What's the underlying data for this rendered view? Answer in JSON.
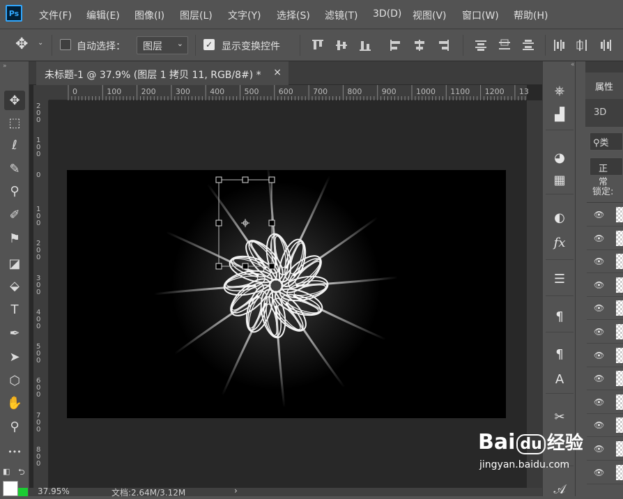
{
  "app": {
    "logo": "Ps"
  },
  "menu": [
    "文件(F)",
    "编辑(E)",
    "图像(I)",
    "图层(L)",
    "文字(Y)",
    "选择(S)",
    "滤镜(T)",
    "3D(D)",
    "视图(V)",
    "窗口(W)",
    "帮助(H)"
  ],
  "options": {
    "auto_select_label": "自动选择：",
    "auto_select_checked": false,
    "target_value": "图层",
    "show_transform_label": "显示变换控件",
    "show_transform_checked": true
  },
  "document": {
    "tab_title": "未标题-1 @ 37.9% (图层 1 拷贝 11, RGB/8#) *",
    "close_symbol": "×"
  },
  "ruler_h": [
    "0",
    "100",
    "200",
    "300",
    "400",
    "500",
    "600",
    "700",
    "800",
    "900",
    "1000",
    "1100",
    "1200",
    "13"
  ],
  "ruler_v": [
    "200",
    "100",
    "0",
    "100",
    "200",
    "300",
    "400",
    "500",
    "600",
    "700",
    "800"
  ],
  "status": {
    "zoom": "37.95%",
    "doc": "文档:2.64M/3.12M",
    "arrow": "›"
  },
  "panel": {
    "properties_tab": "属性",
    "tab_3d": "3D",
    "search_label": "类",
    "blend_mode": "正常",
    "lock_label": "锁定:"
  },
  "tools": [
    {
      "name": "move-tool",
      "glyph": "✥"
    },
    {
      "name": "marquee-tool",
      "glyph": "⬚"
    },
    {
      "name": "lasso-tool",
      "glyph": "ℓ"
    },
    {
      "name": "quick-select-tool",
      "glyph": "✎"
    },
    {
      "name": "eyedropper-tool",
      "glyph": "⚲"
    },
    {
      "name": "brush-tool",
      "glyph": "✐"
    },
    {
      "name": "stamp-tool",
      "glyph": "⚑"
    },
    {
      "name": "eraser-tool",
      "glyph": "◪"
    },
    {
      "name": "paint-bucket-tool",
      "glyph": "⬙"
    },
    {
      "name": "type-tool",
      "glyph": "T"
    },
    {
      "name": "pen-tool",
      "glyph": "✒"
    },
    {
      "name": "path-select-tool",
      "glyph": "➤"
    },
    {
      "name": "shape-tool",
      "glyph": "⬡"
    },
    {
      "name": "hand-tool",
      "glyph": "✋"
    },
    {
      "name": "zoom-tool",
      "glyph": "⚲"
    },
    {
      "name": "more-tools",
      "glyph": "•••"
    }
  ],
  "dock": [
    {
      "name": "navigator-icon",
      "glyph": "⎈"
    },
    {
      "name": "histogram-icon",
      "glyph": "▟"
    },
    {
      "name": "color-icon",
      "glyph": "◕"
    },
    {
      "name": "swatches-icon",
      "glyph": "▦"
    },
    {
      "name": "adjustments-icon",
      "glyph": "◐"
    },
    {
      "name": "styles-icon",
      "glyph": "fx"
    },
    {
      "name": "layer-comps-icon",
      "glyph": "☰"
    },
    {
      "name": "paragraph-icon",
      "glyph": "¶"
    },
    {
      "name": "paragraph-styles-icon",
      "glyph": "¶"
    },
    {
      "name": "character-styles-icon",
      "glyph": "A"
    },
    {
      "name": "tool-presets-icon",
      "glyph": "✂"
    },
    {
      "name": "glyphs-icon",
      "glyph": "𝒜"
    }
  ],
  "watermark": {
    "brand": "Bai",
    "paw": "du",
    "cn": "经验",
    "url": "jingyan.baidu.com"
  }
}
